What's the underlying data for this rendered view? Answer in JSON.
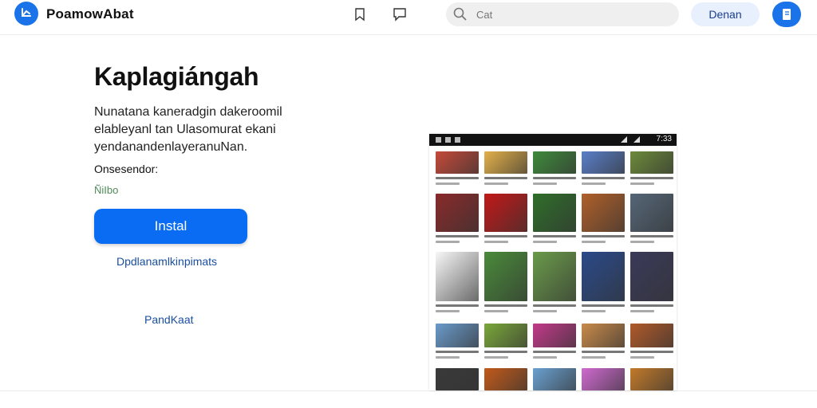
{
  "header": {
    "brand": "PoamowAbat",
    "search_placeholder": "Cat",
    "pill_button": "Denan",
    "colors": {
      "accent": "#1a73e8",
      "pill_bg": "#e8f0fe"
    },
    "icons": [
      "logo-icon",
      "bookmark-icon",
      "chat-icon",
      "search-icon",
      "book-icon"
    ]
  },
  "main": {
    "title": "Kaplagiángah",
    "description": [
      "Nunatana kaneradgin dakeroomil",
      "elableyanl tan Ulasomurat ekani",
      "yendanandenlayeranuNan."
    ],
    "label": "Onsesendor:",
    "rating": "ÑiIbo",
    "install_label": "Instal",
    "link_primary": "Dpdlanamlkinpimats",
    "link_secondary": "PandKaat",
    "colors": {
      "install": "#0a6cf2",
      "link": "#1a4fa0",
      "rating": "#4f8a5a"
    }
  },
  "preview": {
    "status_time": "7:33",
    "tiles": [
      [
        "#c44a3a",
        "#e3b04a",
        "#3f8a3c",
        "#5a7fc9",
        "#6c8a3a"
      ],
      [
        "#8a2a2a",
        "#c21818",
        "#2f6e2a",
        "#b0602a",
        "#556677"
      ],
      [
        "#f7f7f7",
        "#4a8a3a",
        "#6a9a4a",
        "#2a4a8a",
        "#3a3a5a"
      ],
      [
        "#6a9ac9",
        "#7aa83a",
        "#c23a8a",
        "#c98a4a",
        "#b05a2a"
      ],
      [
        "#3a3a3a",
        "#c25a1a",
        "#6aa0d0",
        "#d06ad0",
        "#c27a2a"
      ]
    ]
  }
}
